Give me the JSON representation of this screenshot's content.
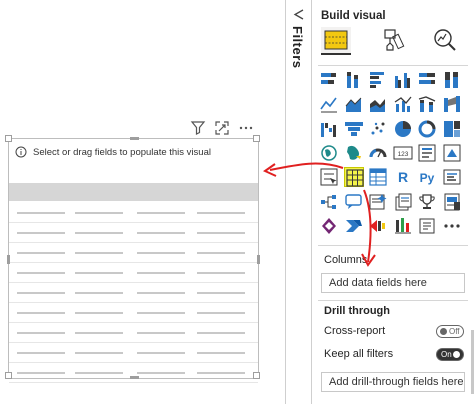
{
  "visual": {
    "hint": "Select or drag fields to populate this visual",
    "table_rows": 9
  },
  "filters_pane": {
    "label": "Filters"
  },
  "build_panel": {
    "title": "Build visual",
    "modes": [
      {
        "name": "build-visual",
        "active": true
      },
      {
        "name": "format-visual",
        "active": false
      },
      {
        "name": "analytics",
        "active": false
      }
    ],
    "visual_types": [
      "stacked-bar",
      "stacked-column",
      "clustered-bar",
      "clustered-column",
      "100-stacked-bar",
      "100-stacked-column",
      "line",
      "area",
      "stacked-area",
      "line-clustered-column",
      "line-stacked-column",
      "ribbon",
      "waterfall",
      "funnel",
      "scatter",
      "pie",
      "donut",
      "treemap",
      "map",
      "filled-map",
      "gauge",
      "card",
      "multi-row-card",
      "kpi",
      "slicer",
      "table",
      "matrix",
      "r-visual",
      "python-visual",
      "key-influencers",
      "decomposition-tree",
      "qa",
      "smart-narrative",
      "paginated",
      "trophy",
      "report-page",
      "power-apps",
      "power-automate",
      "custom-1",
      "custom-2",
      "custom-3",
      "more"
    ],
    "selected_visual": "table",
    "labels": {
      "r_visual": "R",
      "python_visual": "Py",
      "card": "123"
    },
    "columns": {
      "label": "Columns",
      "placeholder": "Add data fields here"
    },
    "drill_through": {
      "title": "Drill through",
      "cross_report": {
        "label": "Cross-report",
        "state": "Off"
      },
      "keep_all_filters": {
        "label": "Keep all filters",
        "state": "On"
      },
      "placeholder": "Add drill-through fields here"
    }
  },
  "colors": {
    "accent": "#f2c811",
    "arrow": "#e02020",
    "selected_bg": "#f5f54a",
    "dark": "#333333"
  }
}
